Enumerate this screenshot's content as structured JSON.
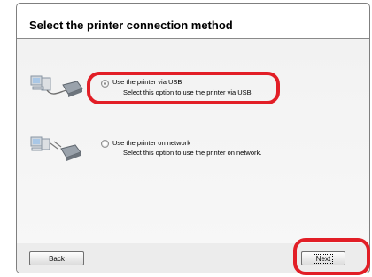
{
  "dialog": {
    "title": "Select the printer connection method",
    "options": [
      {
        "label": "Use the printer via USB",
        "description": "Select this option to use the printer via USB.",
        "selected": true,
        "icon": "usb-printer-icon"
      },
      {
        "label": "Use the printer on network",
        "description": "Select this option to use the printer on network.",
        "selected": false,
        "icon": "network-printer-icon"
      }
    ],
    "back_label": "Back",
    "next_label": "Next"
  },
  "colors": {
    "highlight": "#e21e26",
    "content_bg": "#f4f4f4"
  }
}
